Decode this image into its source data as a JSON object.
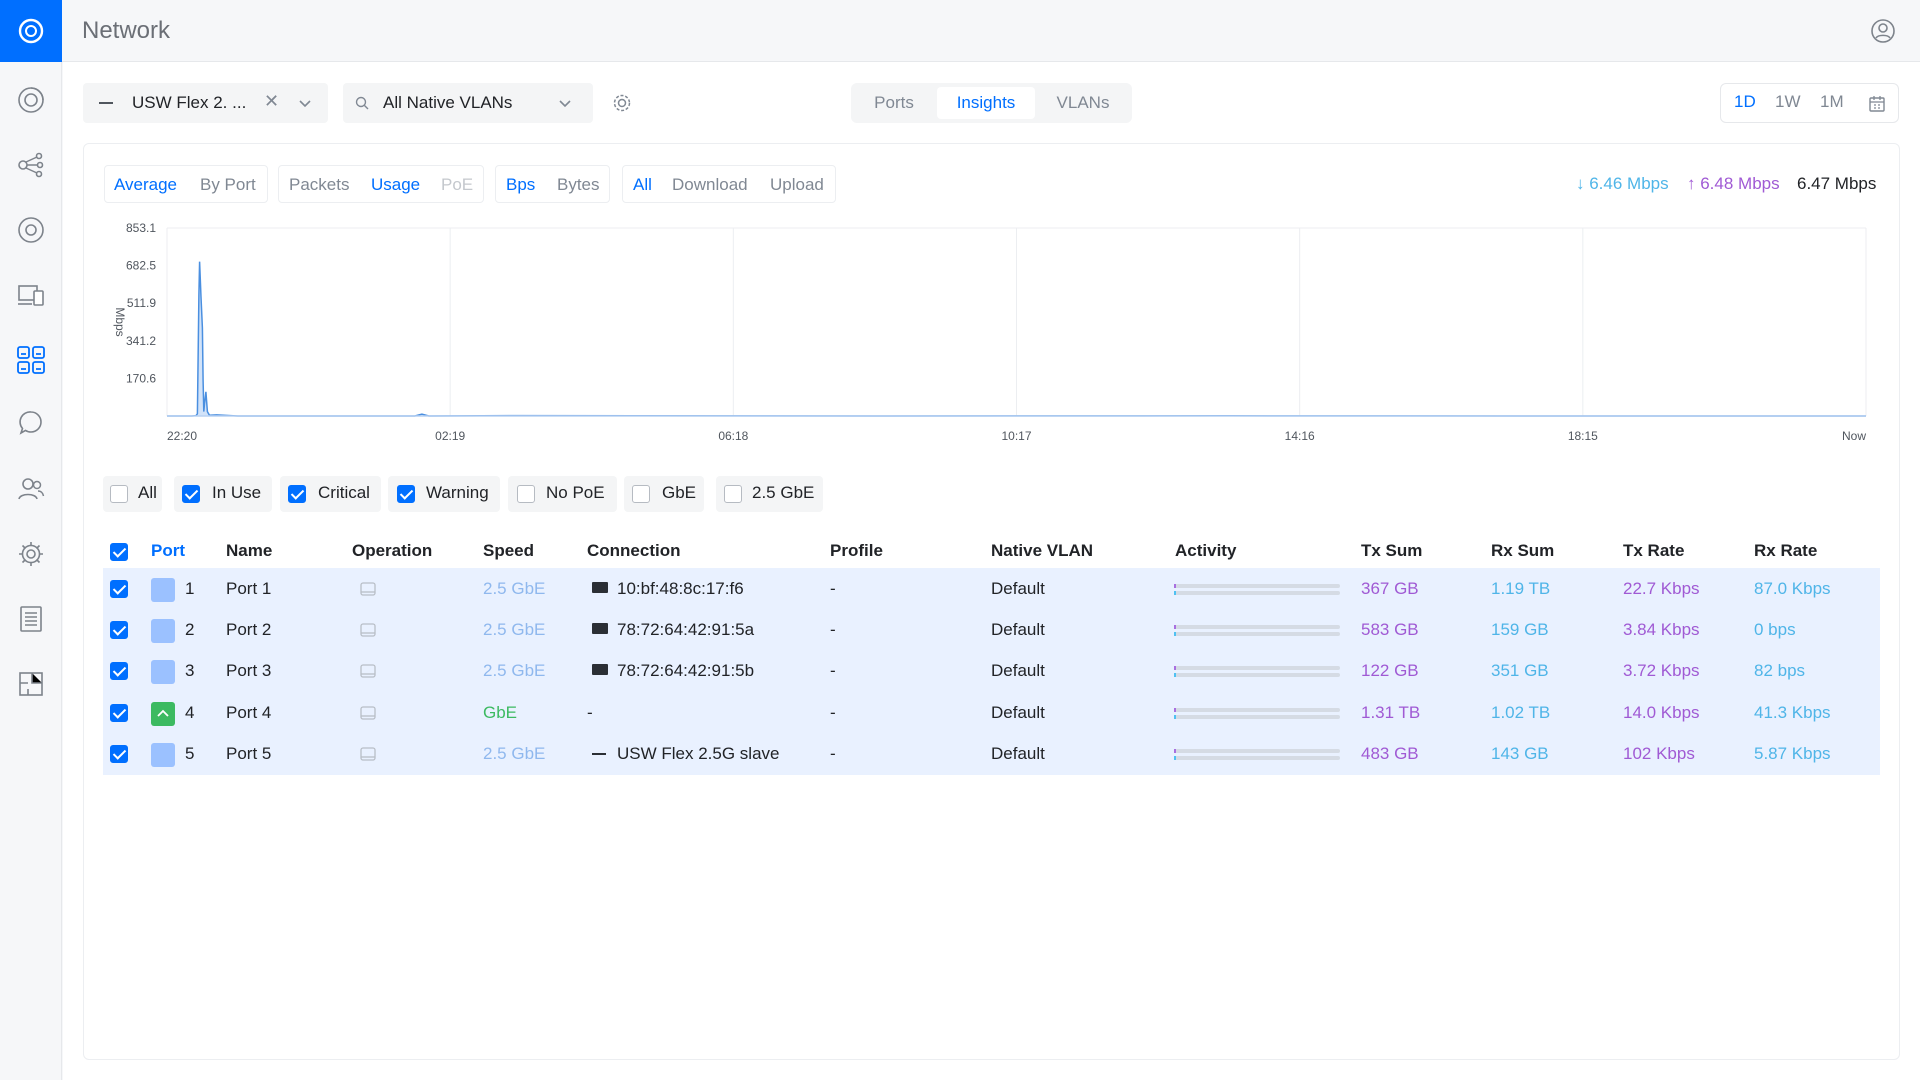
{
  "app": {
    "title": "Network"
  },
  "toolbar": {
    "device": "USW Flex 2. ...",
    "vlan": "All Native VLANs",
    "tabs": [
      {
        "label": "Ports",
        "active": false
      },
      {
        "label": "Insights",
        "active": true
      },
      {
        "label": "VLANs",
        "active": false
      }
    ],
    "ranges": [
      {
        "label": "1D",
        "active": true
      },
      {
        "label": "1W",
        "active": false
      },
      {
        "label": "1M",
        "active": false
      }
    ]
  },
  "toggles": {
    "mode": [
      "Average",
      "By Port"
    ],
    "metric": [
      "Packets",
      "Usage",
      "PoE"
    ],
    "unit": [
      "Bps",
      "Bytes"
    ],
    "direction": [
      "All",
      "Download",
      "Upload"
    ]
  },
  "rates": {
    "download": "↓ 6.46 Mbps",
    "upload": "↑ 6.48 Mbps",
    "total": "6.47 Mbps"
  },
  "chart_data": {
    "type": "area",
    "ylabel": "Mbps",
    "ylim": [
      0,
      853.1
    ],
    "yticks": [
      "853.1",
      "682.5",
      "511.9",
      "341.2",
      "170.6"
    ],
    "xticks": [
      "22:20",
      "02:19",
      "06:18",
      "10:17",
      "14:16",
      "18:15",
      "Now"
    ],
    "x": [
      0,
      0.2,
      0.35,
      0.41,
      0.43,
      0.45,
      0.46,
      0.48,
      0.5,
      0.51,
      0.52,
      0.53,
      0.55,
      0.57,
      0.6,
      0.7,
      1.0,
      3.5,
      3.6,
      3.7,
      5.0,
      10.0,
      15.0,
      20.0,
      24.0
    ],
    "values": [
      0,
      0,
      0,
      2,
      10,
      550,
      700,
      540,
      400,
      160,
      20,
      55,
      110,
      20,
      3,
      5,
      0,
      0,
      8,
      0,
      2,
      0,
      1,
      0,
      0
    ],
    "color": "#4a8fe0"
  },
  "filters": [
    {
      "label": "All",
      "checked": false
    },
    {
      "label": "In Use",
      "checked": true
    },
    {
      "label": "Critical",
      "checked": true
    },
    {
      "label": "Warning",
      "checked": true
    },
    {
      "label": "No PoE",
      "checked": false
    },
    {
      "label": "GbE",
      "checked": false
    },
    {
      "label": "2.5 GbE",
      "checked": false
    }
  ],
  "table": {
    "headers": [
      "Port",
      "Name",
      "Operation",
      "Speed",
      "Connection",
      "Profile",
      "Native VLAN",
      "Activity",
      "Tx Sum",
      "Rx Sum",
      "Tx Rate",
      "Rx Rate"
    ],
    "rows": [
      {
        "port": "1",
        "name": "Port 1",
        "speed": "2.5 GbE",
        "connection": "10:bf:48:8c:17:f6",
        "profile": "-",
        "vlan": "Default",
        "tx_sum": "367 GB",
        "rx_sum": "1.19 TB",
        "tx_rate": "22.7 Kbps",
        "rx_rate": "87.0 Kbps"
      },
      {
        "port": "2",
        "name": "Port 2",
        "speed": "2.5 GbE",
        "connection": "78:72:64:42:91:5a",
        "profile": "-",
        "vlan": "Default",
        "tx_sum": "583 GB",
        "rx_sum": "159 GB",
        "tx_rate": "3.84 Kbps",
        "rx_rate": "0 bps"
      },
      {
        "port": "3",
        "name": "Port 3",
        "speed": "2.5 GbE",
        "connection": "78:72:64:42:91:5b",
        "profile": "-",
        "vlan": "Default",
        "tx_sum": "122 GB",
        "rx_sum": "351 GB",
        "tx_rate": "3.72 Kbps",
        "rx_rate": "82 bps"
      },
      {
        "port": "4",
        "name": "Port 4",
        "speed": "GbE",
        "connection": "-",
        "profile": "-",
        "vlan": "Default",
        "tx_sum": "1.31 TB",
        "rx_sum": "1.02 TB",
        "tx_rate": "14.0 Kbps",
        "rx_rate": "41.3 Kbps"
      },
      {
        "port": "5",
        "name": "Port 5",
        "speed": "2.5 GbE",
        "connection": "USW Flex 2.5G slave",
        "profile": "-",
        "vlan": "Default",
        "tx_sum": "483 GB",
        "rx_sum": "143 GB",
        "tx_rate": "102 Kbps",
        "rx_rate": "5.87 Kbps"
      }
    ]
  },
  "colors": {
    "accent": "#006fff",
    "tx": "#a05ad4",
    "rx": "#4fb5e8",
    "speed_25": "#8fb8ee",
    "speed_gbe": "#3cba61"
  }
}
